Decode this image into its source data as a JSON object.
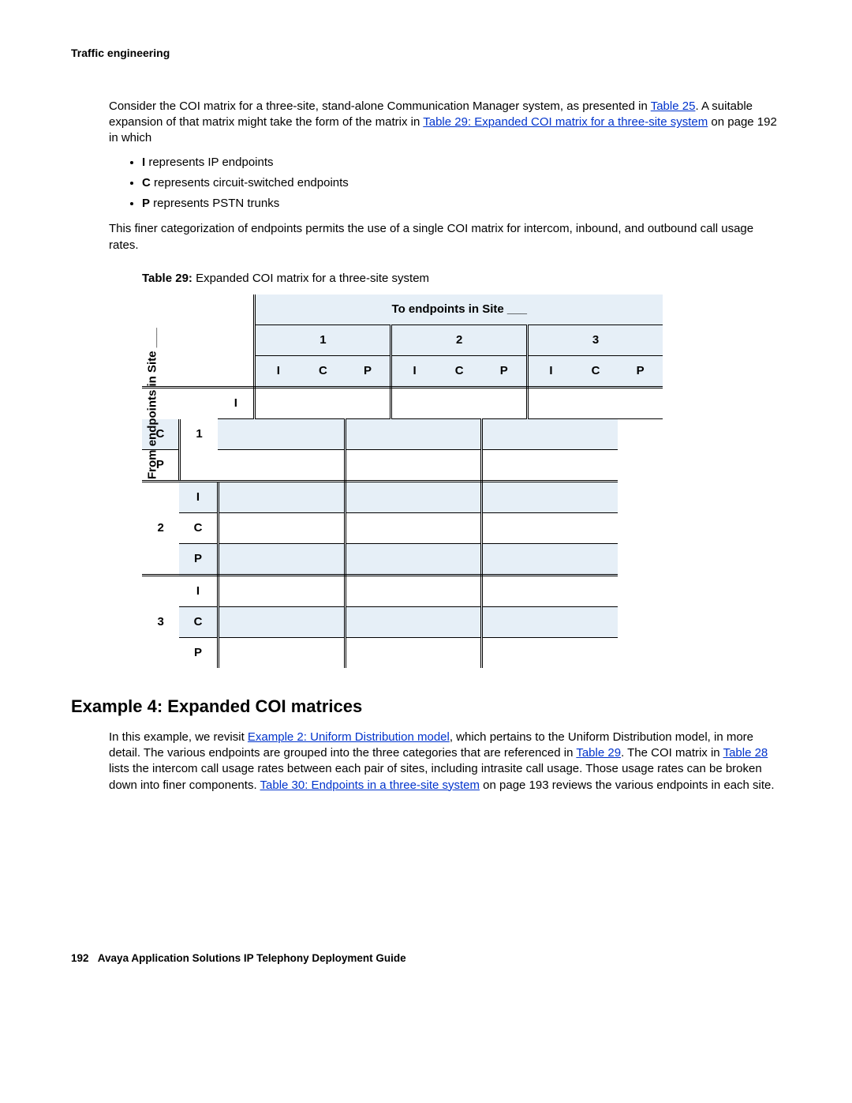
{
  "header": "Traffic engineering",
  "para1_a": "Consider the COI matrix for a three-site, stand-alone Communication Manager system, as presented in ",
  "link_t25": "Table 25",
  "para1_b": ". A suitable expansion of that matrix might take the form of the matrix in ",
  "link_t29_long": "Table 29:  Expanded COI matrix for a three-site system",
  "para1_c": " on page 192 in which",
  "bullet1_b": "I",
  "bullet1_t": " represents IP endpoints",
  "bullet2_b": "C",
  "bullet2_t": " represents circuit-switched endpoints",
  "bullet3_b": "P",
  "bullet3_t": " represents PSTN trunks",
  "para2": "This finer categorization of endpoints permits the use of a single COI matrix for intercom, inbound, and outbound call usage rates.",
  "table_caption_b": "Table 29:",
  "table_caption_t": " Expanded COI matrix for a three-site system",
  "table": {
    "to_header": "To endpoints in Site ___",
    "from_header": "From endpoints in Site ___",
    "sites": [
      "1",
      "2",
      "3"
    ],
    "types": [
      "I",
      "C",
      "P"
    ]
  },
  "example_heading": "Example 4: Expanded COI matrices",
  "p3a": "In this example, we revisit ",
  "link_ex2": "Example 2: Uniform Distribution model",
  "p3b": ", which pertains to the Uniform Distribution model, in more detail. The various endpoints are grouped into the three categories that are referenced in ",
  "link_t29": "Table 29",
  "p3c": ". The COI matrix in ",
  "link_t28": "Table 28",
  "p3d": " lists the intercom call usage rates between each pair of sites, including intrasite call usage. Those usage rates can be broken down into finer components. ",
  "link_t30": "Table 30:  Endpoints in a three-site system",
  "p3e": " on page 193 reviews the various endpoints in each site.",
  "footer_page": "192",
  "footer_text": "Avaya Application Solutions IP Telephony Deployment Guide"
}
